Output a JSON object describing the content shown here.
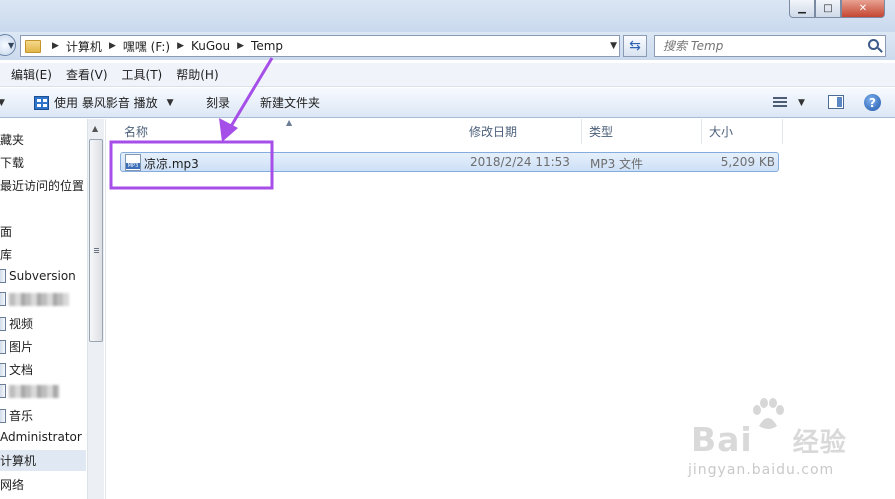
{
  "window": {
    "minimize": "▁",
    "maximize": "□",
    "close": "✕"
  },
  "address": {
    "crumbs": [
      "计算机",
      "嘿嘿 (F:)",
      "KuGou",
      "Temp"
    ]
  },
  "search": {
    "placeholder": "搜索 Temp"
  },
  "menubar": {
    "items": [
      "编辑(E)",
      "查看(V)",
      "工具(T)",
      "帮助(H)"
    ]
  },
  "toolbar": {
    "open_with_label": "使用 暴风影音 播放",
    "burn_label": "刻录",
    "new_folder_label": "新建文件夹",
    "help": "?"
  },
  "navpane": {
    "items": [
      {
        "label": "藏夹"
      },
      {
        "label": "下载"
      },
      {
        "label": "最近访问的位置"
      },
      {
        "label": "面"
      },
      {
        "label": "库"
      },
      {
        "label": "Subversion"
      },
      {
        "label": ""
      },
      {
        "label": "视频"
      },
      {
        "label": "图片"
      },
      {
        "label": "文档"
      },
      {
        "label": ""
      },
      {
        "label": "音乐"
      },
      {
        "label": "Administrator"
      },
      {
        "label": "计算机"
      },
      {
        "label": "网络"
      }
    ]
  },
  "filelist": {
    "columns": [
      "名称",
      "修改日期",
      "类型",
      "大小"
    ],
    "rows": [
      {
        "name": "凉凉.mp3",
        "modified": "2018/2/24 11:53",
        "type": "MP3 文件",
        "size": "5,209 KB"
      }
    ]
  },
  "watermark": {
    "brand": "Bai",
    "brand2": "经验",
    "url": "jingyan.baidu.com"
  },
  "colors": {
    "annotation": "#a64ee8",
    "selection": "#cde0f7"
  }
}
